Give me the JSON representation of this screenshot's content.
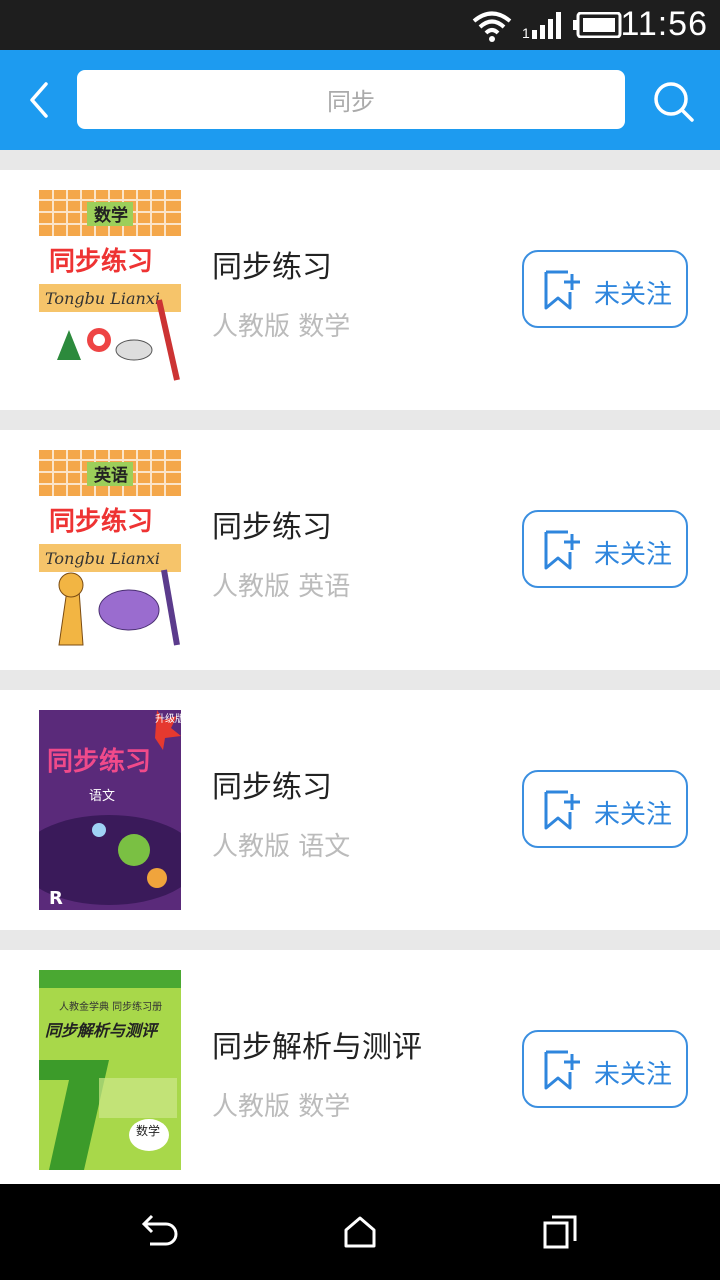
{
  "status_bar": {
    "time": "11:56"
  },
  "search": {
    "placeholder": "同步"
  },
  "items": [
    {
      "title": "同步练习",
      "subtitle": "人教版 数学",
      "follow_label": "未关注",
      "cover": {
        "subject": "数学",
        "title": "同步练习",
        "pinyin": "Tongbu Lianxi"
      }
    },
    {
      "title": "同步练习",
      "subtitle": "人教版 英语",
      "follow_label": "未关注",
      "cover": {
        "subject": "英语",
        "title": "同步练习",
        "pinyin": "Tongbu Lianxi"
      }
    },
    {
      "title": "同步练习",
      "subtitle": "人教版 语文",
      "follow_label": "未关注",
      "cover": {
        "badge": "升级版",
        "title": "同步练习",
        "subject": "语文",
        "mark": "R"
      }
    },
    {
      "title": "同步解析与测评",
      "subtitle": "人教版 数学",
      "follow_label": "未关注",
      "cover": {
        "series": "人教金学典 同步练习册",
        "title": "同步解析与测评",
        "subject": "数学"
      }
    }
  ],
  "colors": {
    "accent": "#1d9bf0",
    "follow_border": "#3b8fe0"
  }
}
